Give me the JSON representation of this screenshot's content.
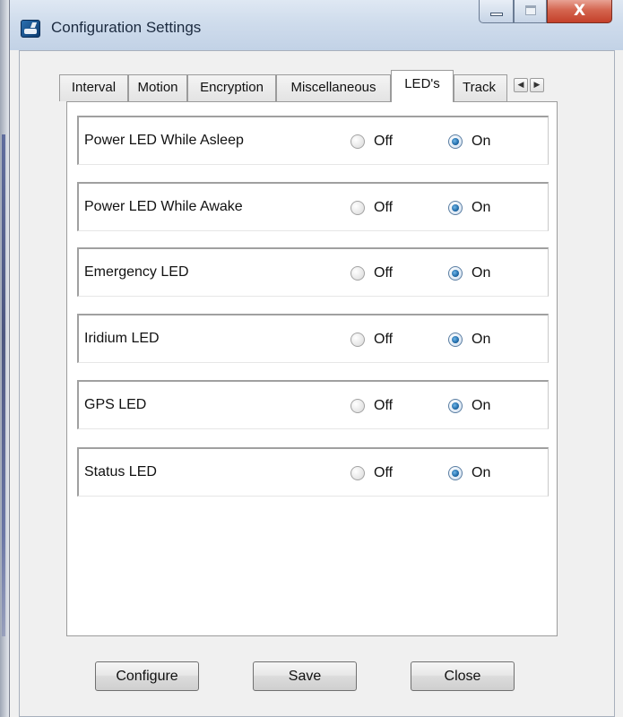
{
  "window": {
    "title": "Configuration Settings",
    "app_icon": "satellite-device-icon",
    "caption_buttons": {
      "minimize": "minimize-icon",
      "maximize": "maximize-icon",
      "close": "X"
    }
  },
  "tabs": [
    {
      "label": "Interval",
      "active": false
    },
    {
      "label": "Motion",
      "active": false
    },
    {
      "label": "Encryption",
      "active": false
    },
    {
      "label": "Miscellaneous",
      "active": false
    },
    {
      "label": "LED's",
      "active": true
    },
    {
      "label": "Track",
      "active": false
    }
  ],
  "tab_scroll": {
    "left": "◀",
    "right": "▶"
  },
  "led_settings": [
    {
      "label": "Power LED While Asleep",
      "off_label": "Off",
      "on_label": "On",
      "value": "On"
    },
    {
      "label": "Power LED While Awake",
      "off_label": "Off",
      "on_label": "On",
      "value": "On"
    },
    {
      "label": "Emergency LED",
      "off_label": "Off",
      "on_label": "On",
      "value": "On"
    },
    {
      "label": "Iridium LED",
      "off_label": "Off",
      "on_label": "On",
      "value": "On"
    },
    {
      "label": "GPS LED",
      "off_label": "Off",
      "on_label": "On",
      "value": "On"
    },
    {
      "label": "Status LED",
      "off_label": "Off",
      "on_label": "On",
      "value": "On"
    }
  ],
  "buttons": {
    "configure": "Configure",
    "save": "Save",
    "close": "Close"
  },
  "colors": {
    "radio_selected": "#1f6aa8",
    "close_button": "#c4402a",
    "titlebar": "#cfdcec"
  }
}
